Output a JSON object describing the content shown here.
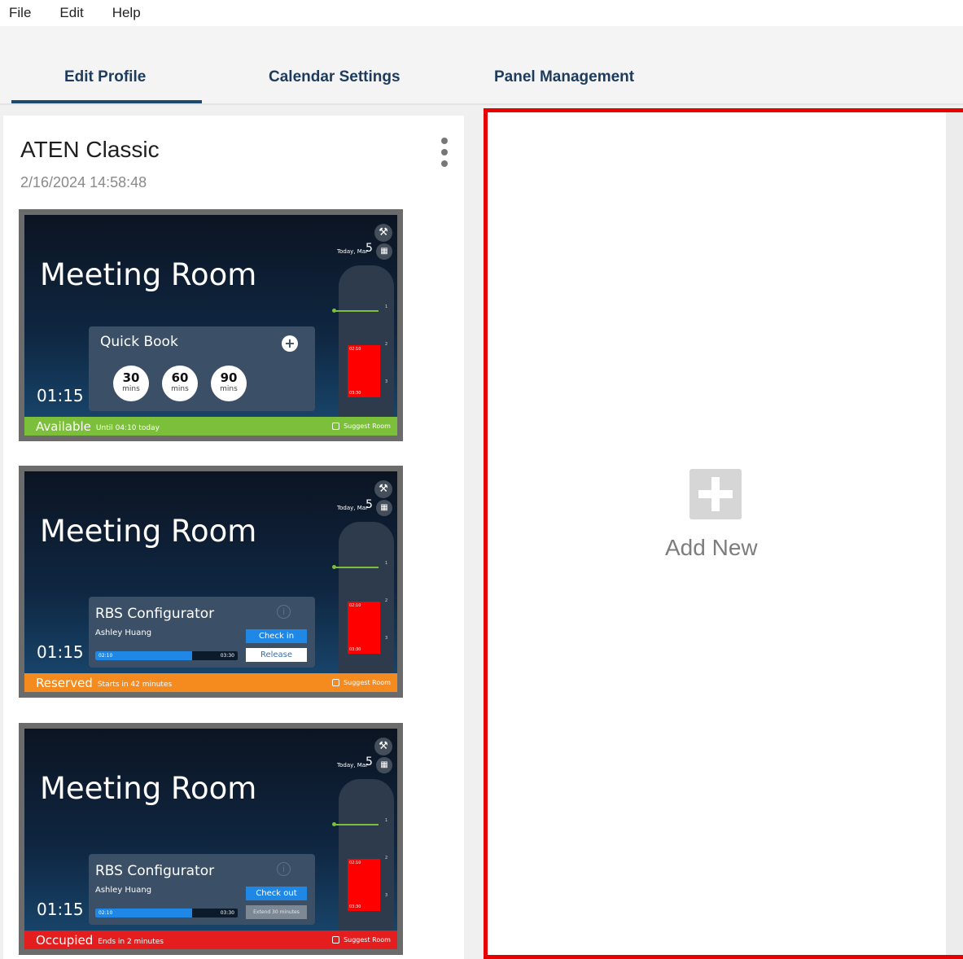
{
  "menu": {
    "file": "File",
    "edit": "Edit",
    "help": "Help"
  },
  "tabs": [
    {
      "label": "Edit Profile",
      "active": true
    },
    {
      "label": "Calendar Settings",
      "active": false
    },
    {
      "label": "Panel Management",
      "active": false
    }
  ],
  "profile": {
    "title": "ATEN Classic",
    "date": "2/16/2024 14:58:48"
  },
  "previews": [
    {
      "room": "Meeting Room",
      "clock": "01:15",
      "date_label": "Today, Mar",
      "date_day": "5",
      "status": "Available",
      "status_sub": "Until 04:10 today",
      "status_color": "#7cbf3a",
      "suggest": "Suggest Room",
      "booking_start": "02:10",
      "booking_end": "03:30",
      "quickbook": {
        "title": "Quick Book",
        "options": [
          {
            "value": "30",
            "unit": "mins"
          },
          {
            "value": "60",
            "unit": "mins"
          },
          {
            "value": "90",
            "unit": "mins"
          }
        ]
      }
    },
    {
      "room": "Meeting Room",
      "clock": "01:15",
      "date_label": "Today, Mar",
      "date_day": "5",
      "status": "Reserved",
      "status_sub": "Starts in 42 minutes",
      "status_color": "#f58a1f",
      "suggest": "Suggest Room",
      "booking_start": "02:10",
      "booking_end": "03:30",
      "meeting": {
        "title": "RBS Configurator",
        "organizer": "Ashley Huang",
        "start": "02:10",
        "end": "03:30",
        "progress": 0.68,
        "button1": "Check in",
        "button2": "Release"
      }
    },
    {
      "room": "Meeting Room",
      "clock": "01:15",
      "date_label": "Today, Mar",
      "date_day": "5",
      "status": "Occupied",
      "status_sub": "Ends in 2 minutes",
      "status_color": "#e41e1e",
      "suggest": "Suggest Room",
      "booking_start": "02:10",
      "booking_end": "03:30",
      "meeting": {
        "title": "RBS Configurator",
        "organizer": "Ashley Huang",
        "start": "02:10",
        "end": "03:30",
        "progress": 0.68,
        "button1": "Check out",
        "button2": "Extend 30 minutes"
      }
    }
  ],
  "timeline_hours": [
    "1",
    "2",
    "3"
  ],
  "add_new": {
    "label": "Add New"
  },
  "colors": {
    "accent": "#1d4a73",
    "highlight_border": "#e60000"
  }
}
